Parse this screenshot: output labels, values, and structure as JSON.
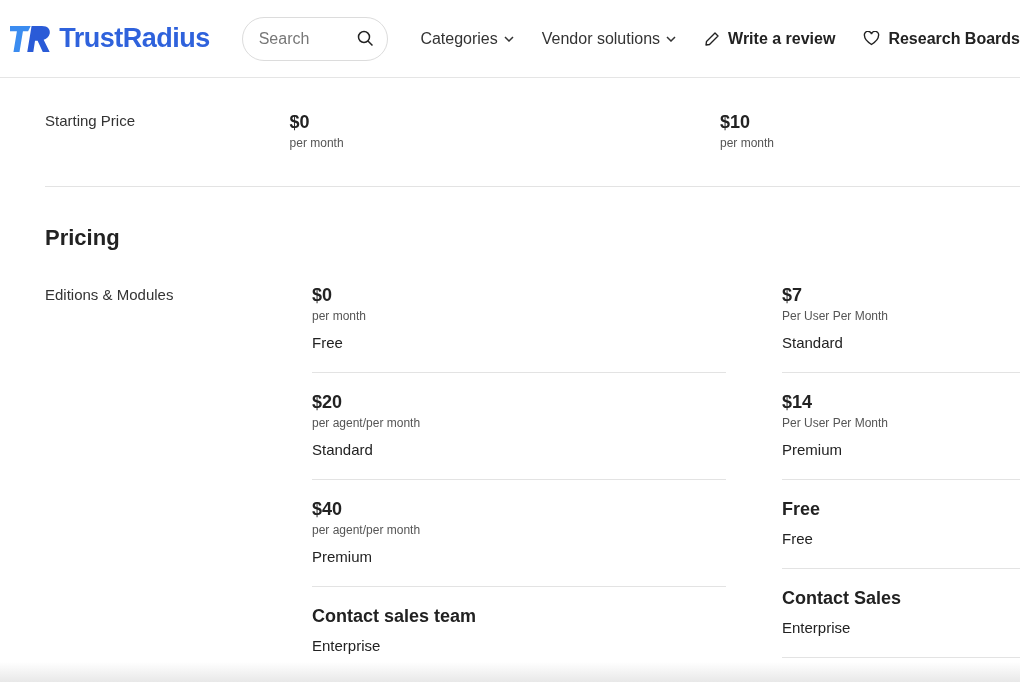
{
  "header": {
    "brand": "TrustRadius",
    "search": {
      "placeholder": "Search"
    },
    "nav": [
      {
        "label": "Categories",
        "kind": "dropdown"
      },
      {
        "label": "Vendor solutions",
        "kind": "dropdown"
      },
      {
        "label": "Write a review",
        "kind": "pencil"
      },
      {
        "label": "Research Boards",
        "kind": "heart"
      }
    ]
  },
  "starting_price": {
    "label": "Starting Price",
    "columns": [
      {
        "price": "$0",
        "note": "per month"
      },
      {
        "price": "$10",
        "note": "per month"
      }
    ]
  },
  "pricing": {
    "title": "Pricing",
    "label": "Editions & Modules",
    "columns": [
      [
        {
          "price": "$0",
          "note": "per month",
          "name": "Free"
        },
        {
          "price": "$20",
          "note": "per agent/per month",
          "name": "Standard"
        },
        {
          "price": "$40",
          "note": "per agent/per month",
          "name": "Premium"
        },
        {
          "price": "Contact sales team",
          "name": "Enterprise"
        }
      ],
      [
        {
          "price": "$7",
          "note": "Per User Per Month",
          "name": "Standard"
        },
        {
          "price": "$14",
          "note": "Per User Per Month",
          "name": "Premium"
        },
        {
          "price": "Free",
          "name": "Free"
        },
        {
          "price": "Contact Sales",
          "name": "Enterprise"
        }
      ]
    ]
  }
}
